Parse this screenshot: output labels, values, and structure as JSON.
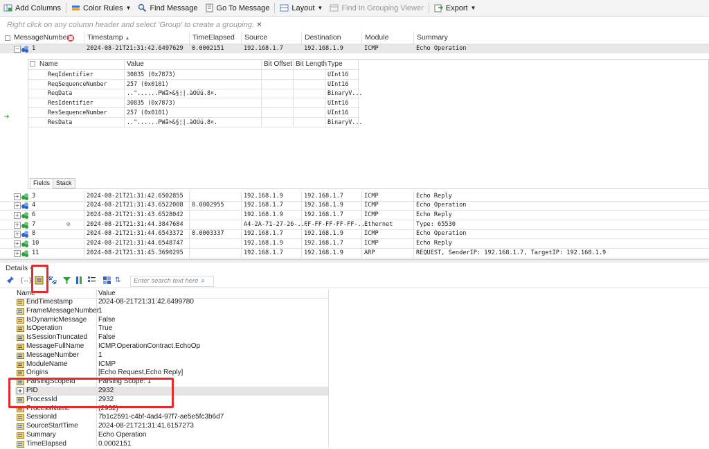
{
  "toolbar": {
    "add_columns": "Add Columns",
    "color_rules": "Color Rules",
    "find_message": "Find Message",
    "go_to_message": "Go To Message",
    "layout": "Layout",
    "find_in_grouping": "Find In Grouping Viewer",
    "export": "Export"
  },
  "group_hint": "Right click on any column header and select 'Group' to create a grouping.",
  "group_hint_close": "×",
  "grid": {
    "columns": [
      "MessageNumber",
      "Timestamp",
      "TimeElapsed",
      "Source",
      "Destination",
      "Module",
      "Summary"
    ],
    "selected_row": {
      "num": "1",
      "timestamp": "2024-08-21T21:31:42.6497629",
      "elapsed": "0.0002151",
      "source": "192.168.1.7",
      "dest": "192.168.1.9",
      "module": "ICMP",
      "summary": "Echo Operation"
    },
    "rows": [
      {
        "num": "3",
        "timestamp": "2024-08-21T21:31:42.6502855",
        "elapsed": "",
        "source": "192.168.1.9",
        "dest": "192.168.1.7",
        "module": "ICMP",
        "summary": "Echo Reply"
      },
      {
        "num": "4",
        "timestamp": "2024-08-21T21:31:43.6522008",
        "elapsed": "0.0002955",
        "source": "192.168.1.7",
        "dest": "192.168.1.9",
        "module": "ICMP",
        "summary": "Echo Operation"
      },
      {
        "num": "6",
        "timestamp": "2024-08-21T21:31:43.6528042",
        "elapsed": "",
        "source": "192.168.1.9",
        "dest": "192.168.1.7",
        "module": "ICMP",
        "summary": "Echo Reply"
      },
      {
        "num": "7",
        "timestamp": "2024-08-21T21:31:44.3847684",
        "elapsed": "",
        "source": "A4-2A-71-27-26-...",
        "dest": "FF-FF-FF-FF-FF-...",
        "module": "Ethernet",
        "summary": "Type: 65530"
      },
      {
        "num": "8",
        "timestamp": "2024-08-21T21:31:44.6543372",
        "elapsed": "0.0003337",
        "source": "192.168.1.7",
        "dest": "192.168.1.9",
        "module": "ICMP",
        "summary": "Echo Operation"
      },
      {
        "num": "10",
        "timestamp": "2024-08-21T21:31:44.6548747",
        "elapsed": "",
        "source": "192.168.1.9",
        "dest": "192.168.1.7",
        "module": "ICMP",
        "summary": "Echo Reply"
      },
      {
        "num": "11",
        "timestamp": "2024-08-21T21:31:45.3690295",
        "elapsed": "",
        "source": "192.168.1.7",
        "dest": "192.168.1.9",
        "module": "ARP",
        "summary": "REQUEST, SenderIP: 192.168.1.7, TargetIP: 192.168.1.9"
      }
    ]
  },
  "fields_panel": {
    "columns": [
      "Name",
      "Value",
      "Bit Offset",
      "Bit Length",
      "Type"
    ],
    "rows": [
      {
        "name": "ReqIdentifier",
        "value": "30835 (0x7873)",
        "type": "UInt16"
      },
      {
        "name": "ReqSequenceNumber",
        "value": "257 (0x0101)",
        "type": "UInt16"
      },
      {
        "name": "ReqData",
        "value": "..\"......PWã>&§¦|.àOÚú.8¤.",
        "type": "BinaryV..."
      },
      {
        "name": "ResIdentifier",
        "value": "30835 (0x7873)",
        "type": "UInt16"
      },
      {
        "name": "ResSequenceNumber",
        "value": "257 (0x0101)",
        "type": "UInt16"
      },
      {
        "name": "ResData",
        "value": "..\"......PWã>&§¦|.àOÚú.8¤.",
        "type": "BinaryV..."
      }
    ],
    "tabs": [
      "Fields",
      "Stack"
    ]
  },
  "details": {
    "label": "Details",
    "search_placeholder": "Enter search text here",
    "columns": [
      "Name",
      "Value"
    ],
    "rows": [
      {
        "name": "EndTimestamp",
        "value": "2024-08-21T21:31:42.6499780"
      },
      {
        "name": "FrameMessageNumber",
        "value": "1"
      },
      {
        "name": "IsDynamicMessage",
        "value": "False"
      },
      {
        "name": "IsOperation",
        "value": "True"
      },
      {
        "name": "IsSessionTruncated",
        "value": "False"
      },
      {
        "name": "MessageFullName",
        "value": "ICMP.OperationContract.EchoOp"
      },
      {
        "name": "MessageNumber",
        "value": "1"
      },
      {
        "name": "ModuleName",
        "value": "ICMP"
      },
      {
        "name": "Origins",
        "value": "[Echo Request,Echo Reply]"
      },
      {
        "name": "ParsingScopeId",
        "value": "Parsing Scope: 1"
      },
      {
        "name": "PID",
        "value": "2932"
      },
      {
        "name": "ProcessId",
        "value": "2932"
      },
      {
        "name": "ProcessName",
        "value": "(2932)"
      },
      {
        "name": "SessionId",
        "value": "7b1c2591-c4bf-4ad4-97f7-ae5e5fc3b6d7"
      },
      {
        "name": "SourceStartTime",
        "value": "2024-08-21T21:31:41.6157273"
      },
      {
        "name": "Summary",
        "value": "Echo Operation"
      },
      {
        "name": "TimeElapsed",
        "value": "0.0002151"
      }
    ]
  },
  "colors": {
    "highlight_red": "#e32b2b",
    "selected_row": "#e8e8e8",
    "icon_green": "#2e9e3a",
    "icon_blue": "#2f64c7"
  }
}
